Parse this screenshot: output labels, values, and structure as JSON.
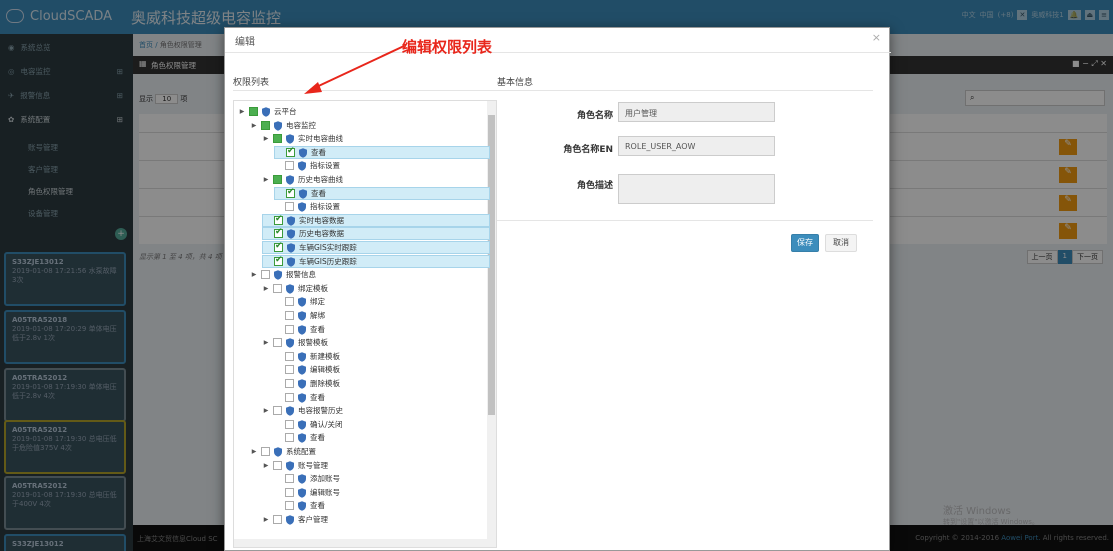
{
  "topbar": {
    "logo_text": "CloudSCADA",
    "title_cn": "奥威科技超级电容监控",
    "lang": "中文",
    "region": "中国",
    "tz": "(+8)",
    "user": "奥威科技1"
  },
  "sidebar": {
    "items": [
      {
        "label": "系统总览"
      },
      {
        "label": "电容监控"
      },
      {
        "label": "报警信息"
      },
      {
        "label": "系统配置"
      },
      {
        "label": "账号管理"
      },
      {
        "label": "客户管理"
      },
      {
        "label": "角色权限管理"
      },
      {
        "label": "设备管理"
      }
    ],
    "alarms": [
      {
        "id": "S33ZJE13012",
        "text": "2019-01-08 17:21:56 水泵故障 3次"
      },
      {
        "id": "A05TRA52018",
        "text": "2019-01-08 17:20:29 单体电压低于2.8v 1次"
      },
      {
        "id": "A05TRA52012",
        "text": "2019-01-08 17:19:30 单体电压低于2.8v 4次"
      },
      {
        "id": "A05TRA52012",
        "text": "2019-01-08 17:19:30 总电压低于危险值375V 4次"
      },
      {
        "id": "A05TRA52012",
        "text": "2019-01-08 17:19:30 总电压低于400V 4次"
      },
      {
        "id": "S33ZJE13012",
        "text": ""
      }
    ]
  },
  "content": {
    "breadcrumb_home": "首页",
    "breadcrumb_current": "角色权限管理",
    "panel_title": "角色权限管理",
    "show_label": "显示",
    "page_size": "10",
    "per_label": "项",
    "footer_info": "显示第 1 至 4 项，共 4 项",
    "prev": "上一页",
    "page": "1",
    "next": "下一页",
    "company": "上海艾文贸信息Cloud SC",
    "copyright": "Copyright © 2014-2016",
    "copyright_link": "Aowei Port.",
    "rights": "All rights reserved.",
    "watermark1": "激活 Windows",
    "watermark2": "转到\"设置\"以激活 Windows。"
  },
  "modal": {
    "title": "编辑",
    "annotation": "编辑权限列表",
    "tree_title": "权限列表",
    "info_title": "基本信息",
    "name_label": "角色名称",
    "name_value": "用户管理",
    "name_en_label": "角色名称EN",
    "name_en_value": "ROLE_USER_AOW",
    "desc_label": "角色描述",
    "desc_value": "",
    "save": "保存",
    "cancel": "取消",
    "tree": [
      {
        "label": "云平台",
        "level": 0,
        "toggle": true,
        "state": "partial",
        "sel": false
      },
      {
        "label": "电容监控",
        "level": 1,
        "toggle": true,
        "state": "partial",
        "sel": false
      },
      {
        "label": "实时电容曲线",
        "level": 2,
        "toggle": true,
        "state": "partial",
        "sel": false
      },
      {
        "label": "查看",
        "level": 3,
        "toggle": false,
        "state": "checked",
        "sel": true
      },
      {
        "label": "指标设置",
        "level": 3,
        "toggle": false,
        "state": "empty",
        "sel": false
      },
      {
        "label": "历史电容曲线",
        "level": 2,
        "toggle": true,
        "state": "partial",
        "sel": false
      },
      {
        "label": "查看",
        "level": 3,
        "toggle": false,
        "state": "checked",
        "sel": true
      },
      {
        "label": "指标设置",
        "level": 3,
        "toggle": false,
        "state": "empty",
        "sel": false
      },
      {
        "label": "实时电容数据",
        "level": 2,
        "toggle": false,
        "state": "checked",
        "sel": true
      },
      {
        "label": "历史电容数据",
        "level": 2,
        "toggle": false,
        "state": "checked",
        "sel": true
      },
      {
        "label": "车辆GIS实时跟踪",
        "level": 2,
        "toggle": false,
        "state": "checked",
        "sel": true
      },
      {
        "label": "车辆GIS历史跟踪",
        "level": 2,
        "toggle": false,
        "state": "checked",
        "sel": true
      },
      {
        "label": "报警信息",
        "level": 1,
        "toggle": true,
        "state": "empty",
        "sel": false
      },
      {
        "label": "绑定模板",
        "level": 2,
        "toggle": true,
        "state": "empty",
        "sel": false
      },
      {
        "label": "绑定",
        "level": 3,
        "toggle": false,
        "state": "empty",
        "sel": false
      },
      {
        "label": "解绑",
        "level": 3,
        "toggle": false,
        "state": "empty",
        "sel": false
      },
      {
        "label": "查看",
        "level": 3,
        "toggle": false,
        "state": "empty",
        "sel": false
      },
      {
        "label": "报警模板",
        "level": 2,
        "toggle": true,
        "state": "empty",
        "sel": false
      },
      {
        "label": "新建模板",
        "level": 3,
        "toggle": false,
        "state": "empty",
        "sel": false
      },
      {
        "label": "编辑模板",
        "level": 3,
        "toggle": false,
        "state": "empty",
        "sel": false
      },
      {
        "label": "删除模板",
        "level": 3,
        "toggle": false,
        "state": "empty",
        "sel": false
      },
      {
        "label": "查看",
        "level": 3,
        "toggle": false,
        "state": "empty",
        "sel": false
      },
      {
        "label": "电容报警历史",
        "level": 2,
        "toggle": true,
        "state": "empty",
        "sel": false
      },
      {
        "label": "确认/关闭",
        "level": 3,
        "toggle": false,
        "state": "empty",
        "sel": false
      },
      {
        "label": "查看",
        "level": 3,
        "toggle": false,
        "state": "empty",
        "sel": false
      },
      {
        "label": "系统配置",
        "level": 1,
        "toggle": true,
        "state": "empty",
        "sel": false
      },
      {
        "label": "账号管理",
        "level": 2,
        "toggle": true,
        "state": "empty",
        "sel": false
      },
      {
        "label": "添加账号",
        "level": 3,
        "toggle": false,
        "state": "empty",
        "sel": false
      },
      {
        "label": "编辑账号",
        "level": 3,
        "toggle": false,
        "state": "empty",
        "sel": false
      },
      {
        "label": "查看",
        "level": 3,
        "toggle": false,
        "state": "empty",
        "sel": false
      },
      {
        "label": "客户管理",
        "level": 2,
        "toggle": true,
        "state": "empty",
        "sel": false
      }
    ]
  }
}
